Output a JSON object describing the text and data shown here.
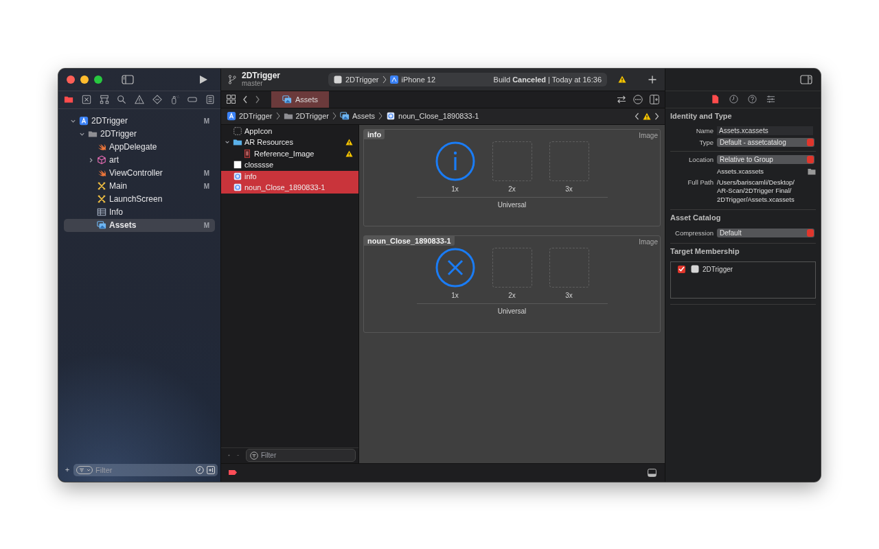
{
  "window": {
    "project": "2DTrigger",
    "branch": "master"
  },
  "activity": {
    "scheme": "2DTrigger",
    "device": "iPhone 12",
    "status": "Build **Canceled** | Today at 16:36",
    "has_warning": true
  },
  "navigator": {
    "tabs": [
      {
        "selected": true
      },
      {
        "selected": false
      },
      {
        "selected": false
      },
      {
        "selected": false
      },
      {
        "selected": false
      },
      {
        "selected": false
      },
      {
        "selected": false
      },
      {
        "selected": false
      },
      {
        "selected": false
      }
    ],
    "tree": [
      {
        "name": "2DTrigger",
        "kind": "project",
        "badge": "M",
        "expanded": true,
        "selected": false,
        "children": [
          {
            "name": "2DTrigger",
            "kind": "folder",
            "expanded": true,
            "selected": false,
            "children": [
              {
                "name": "AppDelegate",
                "kind": "swift",
                "selected": false
              },
              {
                "name": "art",
                "kind": "scene",
                "expanded": false,
                "selected": false
              },
              {
                "name": "ViewController",
                "kind": "swift",
                "badge": "M",
                "selected": false
              },
              {
                "name": "Main",
                "kind": "storyboard",
                "badge": "M",
                "selected": false
              },
              {
                "name": "LaunchScreen",
                "kind": "storyboard",
                "selected": false
              },
              {
                "name": "Info",
                "kind": "plist",
                "selected": false
              },
              {
                "name": "Assets",
                "kind": "assets",
                "badge": "M",
                "selected": true
              }
            ]
          }
        ]
      }
    ],
    "filter": {
      "placeholder": "Filter"
    }
  },
  "editor_tabs": [
    {
      "label": "Assets",
      "selected": true
    }
  ],
  "jump_bar": {
    "items": [
      {
        "label": "2DTrigger",
        "kind": "project"
      },
      {
        "label": "2DTrigger",
        "kind": "folder"
      },
      {
        "label": "Assets",
        "kind": "assets"
      },
      {
        "label": "noun_Close_1890833-1",
        "kind": "imageset"
      }
    ],
    "has_warning": true
  },
  "asset_list": {
    "items": [
      {
        "name": "AppIcon",
        "kind": "appicon",
        "selected": false,
        "warning": false
      },
      {
        "name": "AR Resources",
        "kind": "group",
        "expanded": true,
        "warning": true,
        "selected": false,
        "children": [
          {
            "name": "Reference_Image",
            "kind": "arimage",
            "warning": true,
            "selected": false
          }
        ]
      },
      {
        "name": "closssse",
        "kind": "image",
        "selected": false,
        "warning": false
      },
      {
        "name": "info",
        "kind": "imageset",
        "selected": true,
        "warning": false
      },
      {
        "name": "noun_Close_1890833-1",
        "kind": "imageset",
        "selected": true,
        "warning": false
      }
    ],
    "filter": {
      "placeholder": "Filter"
    }
  },
  "image_sets": [
    {
      "name": "info",
      "type_label": "Image",
      "kind": "info",
      "slots": [
        {
          "label": "1x",
          "filled": true
        },
        {
          "label": "2x",
          "filled": false
        },
        {
          "label": "3x",
          "filled": false
        }
      ],
      "idiom": "Universal"
    },
    {
      "name": "noun_Close_1890833-1",
      "type_label": "Image",
      "kind": "close",
      "slots": [
        {
          "label": "1x",
          "filled": true
        },
        {
          "label": "2x",
          "filled": false
        },
        {
          "label": "3x",
          "filled": false
        }
      ],
      "idiom": "Universal"
    }
  ],
  "inspector": {
    "tabs": [
      {
        "selected": true
      },
      {
        "selected": false
      },
      {
        "selected": false
      },
      {
        "selected": false
      }
    ],
    "identity": {
      "title": "Identity and Type",
      "name_label": "Name",
      "name": "Assets.xcassets",
      "type_label": "Type",
      "type": "Default - assetcatalog",
      "location_label": "Location",
      "location": "Relative to Group",
      "location_file": "Assets.xcassets",
      "full_path_label": "Full Path",
      "full_path_lines": [
        "/Users/bariscamli/Desktop/",
        "AR-Scan/2DTrigger Final/",
        "2DTrigger/Assets.xcassets"
      ]
    },
    "asset_catalog": {
      "title": "Asset Catalog",
      "compression_label": "Compression",
      "compression": "Default"
    },
    "target_membership": {
      "title": "Target Membership",
      "targets": [
        {
          "name": "2DTrigger",
          "checked": true
        }
      ]
    }
  },
  "debug_bar": {
    "breakpoints_active": true
  }
}
